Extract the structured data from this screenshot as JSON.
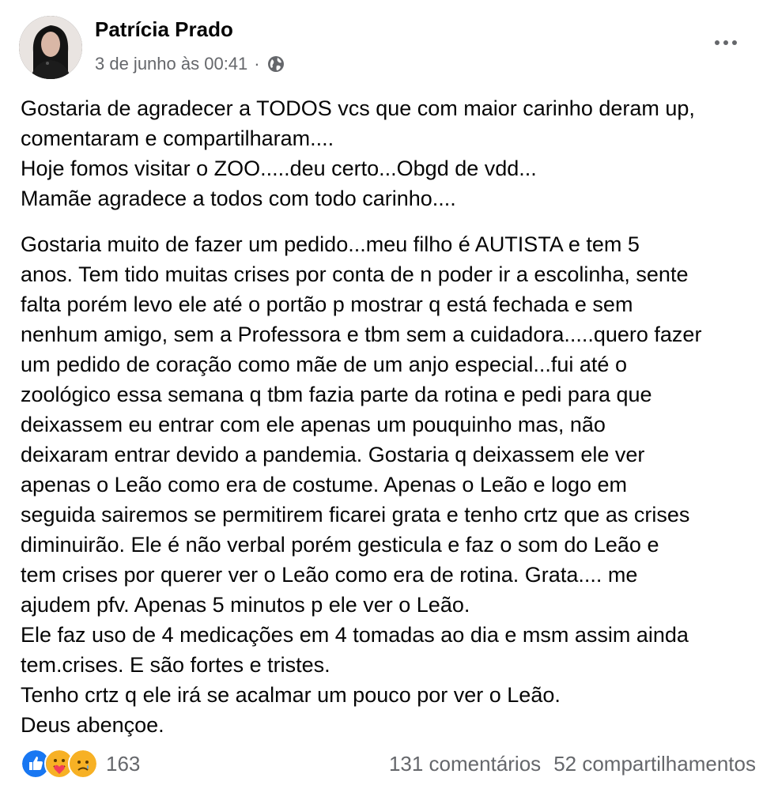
{
  "post": {
    "author": "Patrícia Prado",
    "timestamp": "3 de junho às 00:41",
    "separator": "·",
    "privacy_icon": "globe-icon",
    "more_icon": "more-options-icon",
    "paragraphs": [
      [
        "Gostaria de agradecer a TODOS vcs que com maior carinho deram up,",
        "comentaram e compartilharam....",
        "Hoje fomos visitar o ZOO.....deu certo...Obgd de vdd...",
        "Mamãe agradece a todos com todo carinho...."
      ],
      [
        "Gostaria muito de fazer um pedido...meu filho é AUTISTA e tem 5",
        "anos. Tem tido muitas crises por conta de n poder ir a escolinha, sente",
        "falta porém levo ele até o portão p mostrar q está fechada e sem",
        "nenhum amigo, sem a Professora e tbm sem a cuidadora.....quero fazer",
        "um pedido de coração como mãe de um anjo especial...fui até o",
        "zoológico essa semana q tbm fazia parte da rotina e pedi para que",
        "deixassem eu entrar com ele apenas um pouquinho mas, não",
        "deixaram entrar devido a pandemia. Gostaria q deixassem ele ver",
        "apenas o Leão como era de costume. Apenas o Leão e logo em",
        "seguida sairemos se permitirem ficarei grata e tenho crtz que as crises",
        "diminuirão.  Ele é não verbal porém gesticula e faz o som do Leão e",
        "tem crises por querer ver o Leão como era de rotina. Grata.... me",
        "ajudem pfv.  Apenas 5 minutos p ele ver o Leão.",
        "Ele faz uso de 4 medicações em 4 tomadas ao dia e msm assim ainda",
        "tem.crises. E são fortes e tristes.",
        "Tenho crtz q ele irá se acalmar um pouco por ver o Leão.",
        "Deus abençoe."
      ]
    ],
    "footer": {
      "reaction_icons": [
        "like-icon",
        "care-icon",
        "sad-icon"
      ],
      "reaction_count": "163",
      "comments": "131 comentários",
      "shares": "52 compartilhamentos"
    }
  },
  "colors": {
    "like": "#1877f2",
    "care": "#f7b125",
    "sad": "#f7b125",
    "secondary_text": "#65676b"
  }
}
